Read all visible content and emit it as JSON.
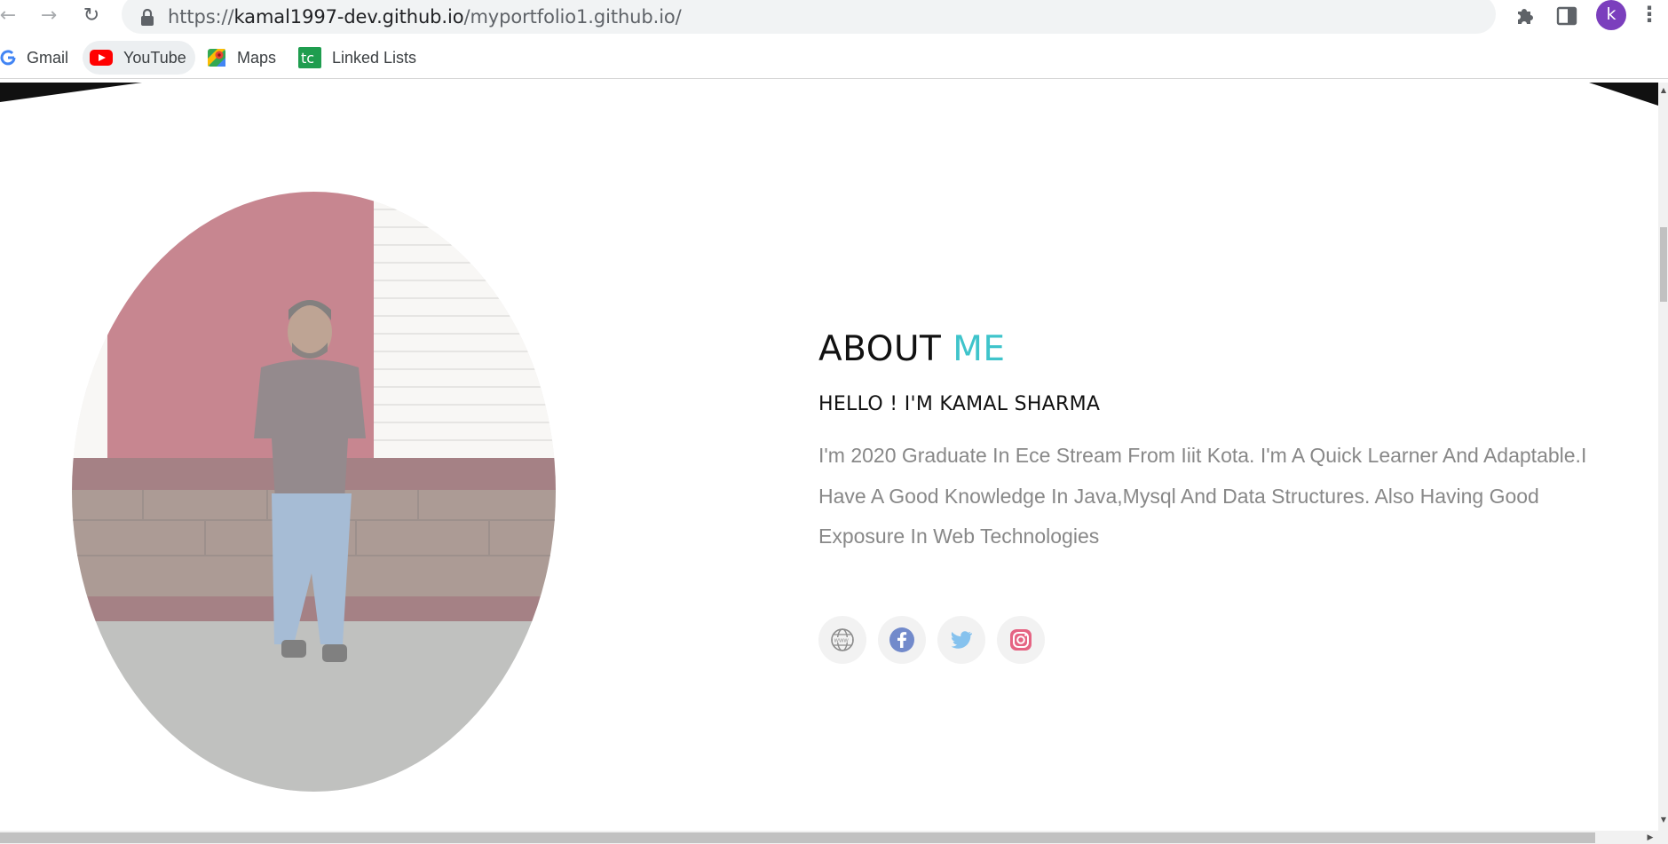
{
  "browser": {
    "url_host": "kamal1997-dev.github.io",
    "url_path": "/myportfolio1.github.io/",
    "url_scheme": "https://",
    "profile_initial": "k",
    "menu_glyph": "⋮",
    "nav": {
      "back_glyph": "←",
      "forward_glyph": "→",
      "reload_glyph": "↻"
    }
  },
  "bookmarks": [
    {
      "label": "Gmail",
      "icon": "google-icon"
    },
    {
      "label": "YouTube",
      "icon": "youtube-icon"
    },
    {
      "label": "Maps",
      "icon": "maps-icon"
    },
    {
      "label": "Linked Lists",
      "icon": "tc-icon"
    }
  ],
  "about": {
    "heading_main": "ABOUT",
    "heading_accent": "ME",
    "subheading": "HELLO ! I'M KAMAL SHARMA",
    "bio": "I'm 2020 Graduate In Ece Stream From Iiit Kota. I'm A Quick Learner And Adaptable.I Have A Good Knowledge In Java,Mysql And Data Structures. Also Having Good Exposure In Web Technologies"
  },
  "socials": [
    {
      "icon": "globe-icon"
    },
    {
      "icon": "facebook-icon"
    },
    {
      "icon": "twitter-icon"
    },
    {
      "icon": "instagram-icon"
    }
  ],
  "colors": {
    "accent": "#3fc4cb",
    "bio_text": "#888888",
    "avatar": "#7b3fbd"
  }
}
